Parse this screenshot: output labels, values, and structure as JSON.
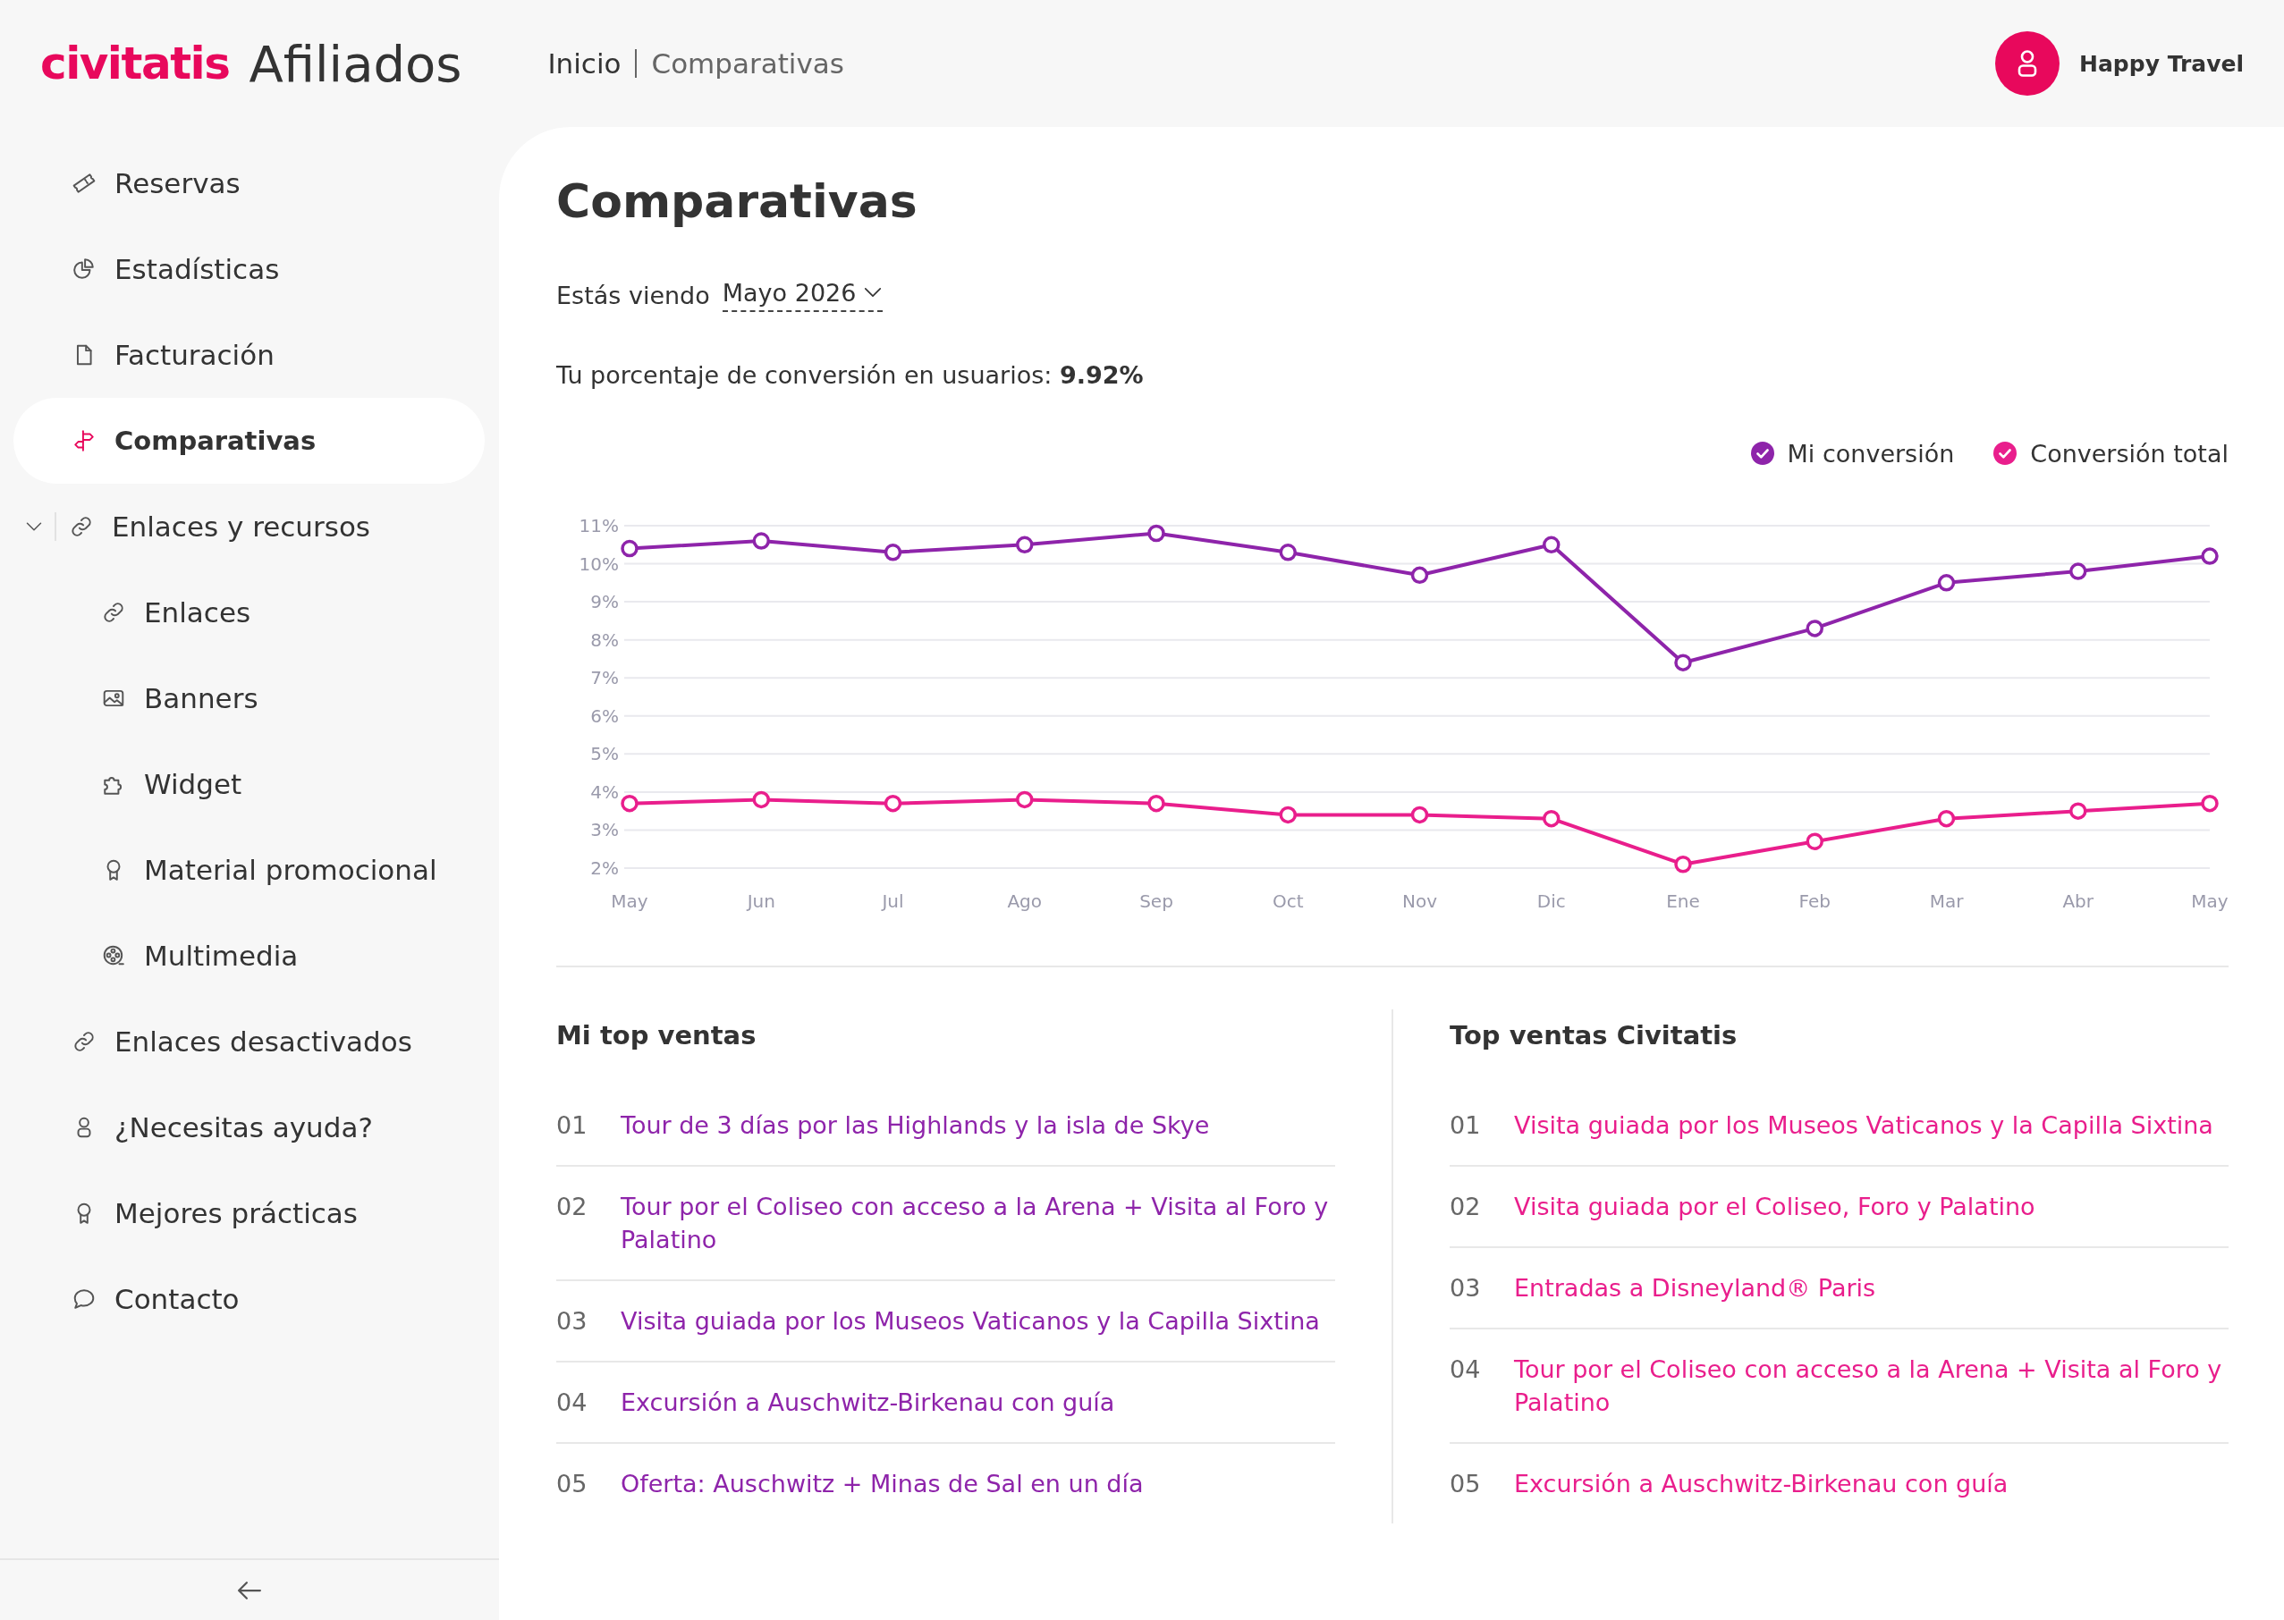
{
  "header": {
    "logo": "civitatis",
    "product": "Afiliados",
    "breadcrumb": [
      {
        "label": "Inicio",
        "selected": false
      },
      {
        "label": "Comparativas",
        "selected": true
      }
    ],
    "user": {
      "name": "Happy Travel"
    }
  },
  "sidebar": {
    "items": [
      {
        "label": "Reservas",
        "selected": false
      },
      {
        "label": "Estadísticas",
        "selected": false
      },
      {
        "label": "Facturación",
        "selected": false
      },
      {
        "label": "Comparativas",
        "selected": true
      },
      {
        "label": "Enlaces y recursos",
        "selected": false,
        "expanded": true,
        "children": [
          {
            "label": "Enlaces",
            "selected": false
          },
          {
            "label": "Banners",
            "selected": false
          },
          {
            "label": "Widget",
            "selected": false
          },
          {
            "label": "Material promocional",
            "selected": false
          },
          {
            "label": "Multimedia",
            "selected": false
          }
        ]
      },
      {
        "label": "Enlaces desactivados",
        "selected": false
      },
      {
        "label": "¿Necesitas ayuda?",
        "selected": false
      },
      {
        "label": "Mejores prácticas",
        "selected": false
      },
      {
        "label": "Contacto",
        "selected": false
      }
    ]
  },
  "page": {
    "title": "Comparativas",
    "period": {
      "label": "Estás viendo",
      "value": "Mayo 2026"
    },
    "conversion": "Tu porcentaje de conversión en usuarios: **9.92%**",
    "chart": {
      "legend": [
        {
          "checked": true
        },
        {
          "checked": true
        }
      ],
      "chart_data": {
        "type": "line",
        "grid": true,
        "categories": [
          "May",
          "Jun",
          "Jul",
          "Ago",
          "Sep",
          "Oct",
          "Nov",
          "Dic",
          "Ene",
          "Feb",
          "Mar",
          "Abr",
          "May"
        ],
        "series": [
          {
            "name": "Mi conversión",
            "color": "#8e24aa",
            "marker": "circle",
            "values": [
              10.4,
              10.6,
              10.3,
              10.5,
              10.8,
              10.3,
              9.7,
              10.5,
              7.4,
              8.3,
              9.5,
              9.8,
              10.2
            ]
          },
          {
            "name": "Conversión total",
            "color": "#e91e8c",
            "marker": "circle",
            "values": [
              3.7,
              3.8,
              3.7,
              3.8,
              3.7,
              3.4,
              3.4,
              3.3,
              2.1,
              2.7,
              3.3,
              3.5,
              3.7
            ]
          }
        ],
        "ylim": [
          2,
          11
        ],
        "yticks": [
          {
            "value": 2,
            "label": "2%"
          },
          {
            "value": 3,
            "label": "3%"
          },
          {
            "value": 4,
            "label": "4%"
          },
          {
            "value": 5,
            "label": "5%"
          },
          {
            "value": 6,
            "label": "6%"
          },
          {
            "value": 7,
            "label": "7%"
          },
          {
            "value": 8,
            "label": "8%"
          },
          {
            "value": 9,
            "label": "9%"
          },
          {
            "value": 10,
            "label": "10%"
          },
          {
            "value": 11,
            "label": "11%"
          }
        ]
      }
    },
    "top_lists": [
      {
        "title": "Mi top ventas",
        "color": "#8e24aa",
        "items": [
          {
            "rank": "01",
            "title": "Tour de 3 días por las Highlands y la isla de Skye"
          },
          {
            "rank": "02",
            "title": "Tour por el Coliseo con acceso a la Arena + Visita al Foro y Palatino"
          },
          {
            "rank": "03",
            "title": "Visita guiada por los Museos Vaticanos y la Capilla Sixtina"
          },
          {
            "rank": "04",
            "title": "Excursión a Auschwitz-Birkenau con guía"
          },
          {
            "rank": "05",
            "title": "Oferta: Auschwitz + Minas de Sal en un día"
          }
        ]
      },
      {
        "title": "Top ventas Civitatis",
        "color": "#e91e8c",
        "items": [
          {
            "rank": "01",
            "title": "Visita guiada por los Museos Vaticanos y la Capilla Sixtina"
          },
          {
            "rank": "02",
            "title": "Visita guiada por el Coliseo, Foro y Palatino"
          },
          {
            "rank": "03",
            "title": "Entradas a Disneyland® Paris"
          },
          {
            "rank": "04",
            "title": "Tour por el Coliseo con acceso a la Arena + Visita al Foro y Palatino"
          },
          {
            "rank": "05",
            "title": "Excursión a Auschwitz-Birkenau con guía"
          }
        ]
      }
    ]
  }
}
